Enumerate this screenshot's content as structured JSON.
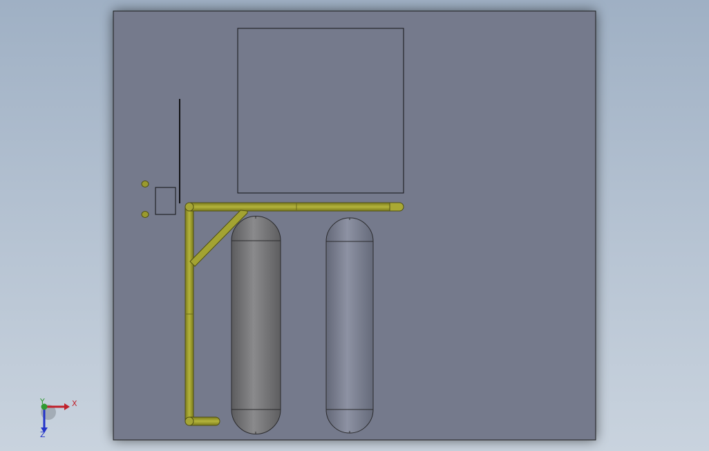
{
  "viewport": {
    "background_top": "#9fb0c4",
    "background_bottom": "#c9d3de"
  },
  "model": {
    "panel_color": "#757a8c",
    "panel_edge": "#1b1b1f",
    "pipe_color": "#9a9a2e",
    "pipe_edge": "#4f4f12",
    "tank_left_color": "#7b7b7d",
    "tank_right_color": "#808597"
  },
  "triad": {
    "x_label": "X",
    "y_label": "Y",
    "z_label": "Z",
    "x_color": "#c0202a",
    "y_color": "#2f9a32",
    "z_color": "#2333c9"
  }
}
